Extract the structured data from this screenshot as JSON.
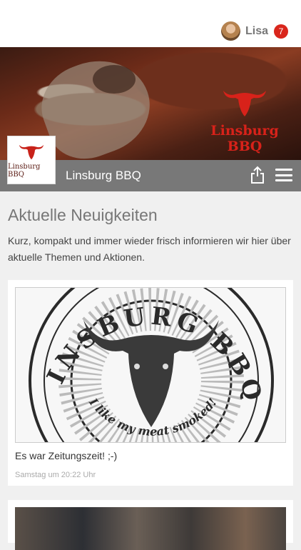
{
  "user": {
    "name": "Lisa",
    "notification_count": "7"
  },
  "brand": {
    "name": "Linsburg BBQ",
    "logo_text": "Linsburg BBQ",
    "hero_logo_text": "Linsburg BBQ",
    "accent": "#d8221a"
  },
  "header": {
    "share_icon": "share-icon",
    "menu_icon": "menu-icon"
  },
  "news": {
    "title": "Aktuelle Neuigkeiten",
    "description": "Kurz, kompakt und immer wieder frisch informieren wir hier über aktuelle Themen und Aktionen.",
    "items": [
      {
        "title": "Es war Zeitungszeit! ;-)",
        "meta": "Samstag um 20:22 Uhr",
        "image_stamp_top": "LINSBURG BBQ",
        "image_stamp_bottom": "I like my meat smoked!"
      },
      {
        "title": "",
        "meta": ""
      }
    ]
  }
}
